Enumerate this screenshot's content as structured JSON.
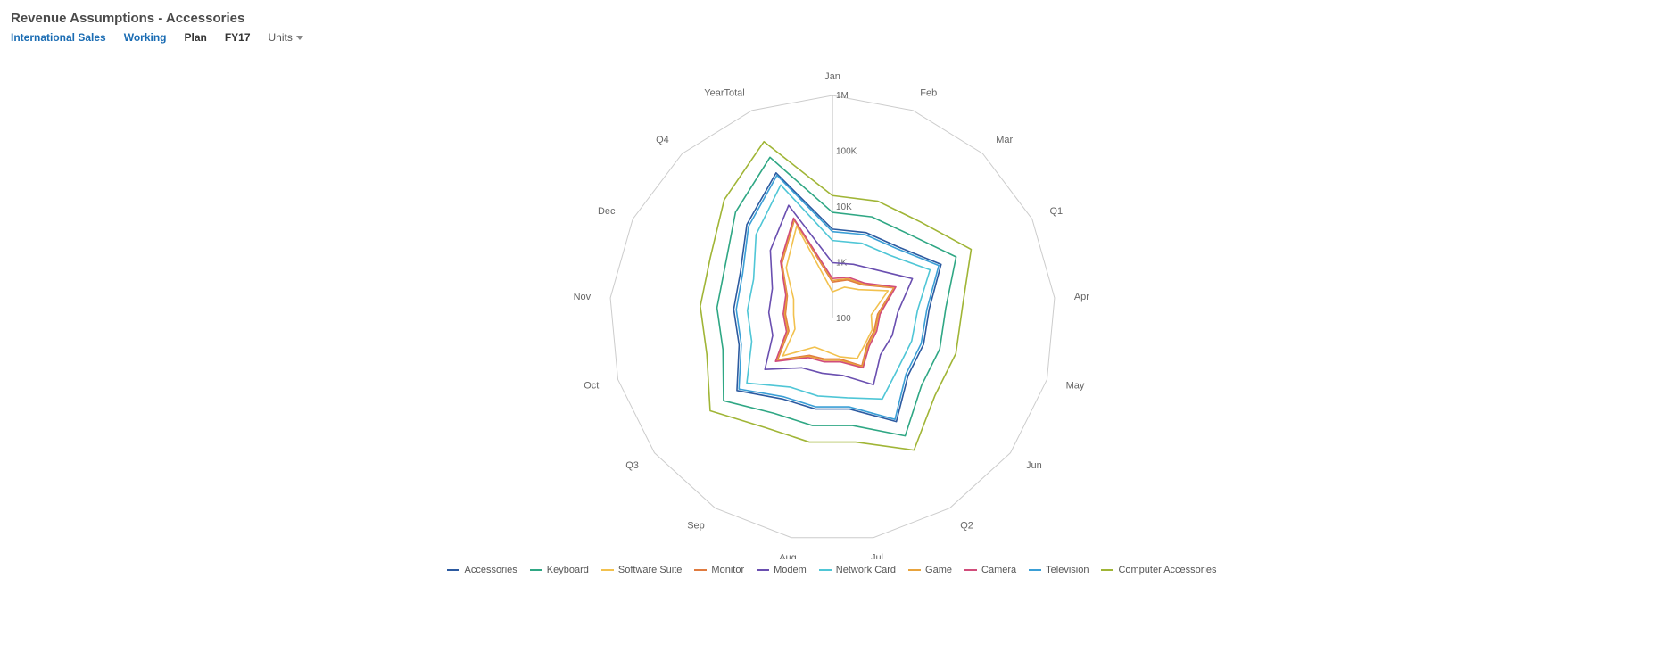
{
  "header": {
    "title": "Revenue Assumptions - Accessories",
    "filters": {
      "market": "International Sales",
      "version": "Working",
      "scenario": "Plan",
      "year": "FY17",
      "uom": "Units"
    }
  },
  "chart_data": {
    "type": "radar",
    "scale": "log",
    "categories": [
      "Jan",
      "Feb",
      "Mar",
      "Q1",
      "Apr",
      "May",
      "Jun",
      "Q2",
      "Jul",
      "Aug",
      "Sep",
      "Q3",
      "Oct",
      "Nov",
      "Dec",
      "Q4",
      "YearTotal"
    ],
    "ticks": [
      100,
      1000,
      10000,
      100000,
      1000000
    ],
    "tick_labels": [
      "100",
      "1K",
      "10K",
      "100K",
      "1M"
    ],
    "series": [
      {
        "name": "Accessories",
        "color": "#2c5aa0",
        "values": [
          4000,
          4500,
          5500,
          15000,
          5500,
          5000,
          5000,
          15000,
          4500,
          4500,
          5000,
          14000,
          5500,
          6000,
          7000,
          19000,
          63000
        ]
      },
      {
        "name": "Keyboard",
        "color": "#2fa784",
        "values": [
          8000,
          9000,
          11000,
          30000,
          11000,
          10000,
          10000,
          30000,
          9000,
          9000,
          10000,
          28000,
          11000,
          12000,
          14000,
          38000,
          126000
        ]
      },
      {
        "name": "Software Suite",
        "color": "#f2c14e",
        "values": [
          300,
          400,
          500,
          1300,
          500,
          550,
          550,
          700,
          500,
          400,
          400,
          1300,
          500,
          500,
          600,
          1700,
          6000
        ]
      },
      {
        "name": "Monitor",
        "color": "#e07b3f",
        "values": [
          450,
          550,
          650,
          1700,
          650,
          600,
          600,
          1000,
          550,
          550,
          600,
          1700,
          650,
          700,
          800,
          2200,
          7800
        ]
      },
      {
        "name": "Modem",
        "color": "#6a4fb0",
        "values": [
          1000,
          1100,
          1500,
          4000,
          1500,
          1300,
          1200,
          2500,
          1100,
          1000,
          1100,
          3300,
          1300,
          1400,
          1600,
          4500,
          15000
        ]
      },
      {
        "name": "Network Card",
        "color": "#4fc6d6",
        "values": [
          2500,
          2800,
          3400,
          9000,
          3400,
          3000,
          3000,
          5000,
          2800,
          2600,
          2800,
          8400,
          3200,
          3400,
          3800,
          10800,
          37000
        ]
      },
      {
        "name": "Game",
        "color": "#e8a33d",
        "values": [
          480,
          580,
          680,
          1760,
          680,
          630,
          630,
          1050,
          580,
          580,
          630,
          1790,
          680,
          730,
          820,
          2270,
          8000
        ]
      },
      {
        "name": "Camera",
        "color": "#d14d7b",
        "values": [
          520,
          620,
          720,
          1860,
          720,
          670,
          670,
          1100,
          620,
          620,
          670,
          1900,
          720,
          770,
          860,
          2400,
          8500
        ]
      },
      {
        "name": "Television",
        "color": "#3a9fd6",
        "values": [
          3600,
          4100,
          5000,
          13500,
          5000,
          4500,
          4500,
          13500,
          4100,
          4100,
          4500,
          12600,
          5000,
          5400,
          6300,
          17100,
          56700
        ]
      },
      {
        "name": "Computer Accessories",
        "color": "#a0b536",
        "values": [
          16000,
          18000,
          22000,
          60000,
          22000,
          20000,
          20000,
          60000,
          18000,
          18000,
          20000,
          56000,
          22000,
          24000,
          28000,
          76000,
          252000
        ]
      }
    ]
  }
}
